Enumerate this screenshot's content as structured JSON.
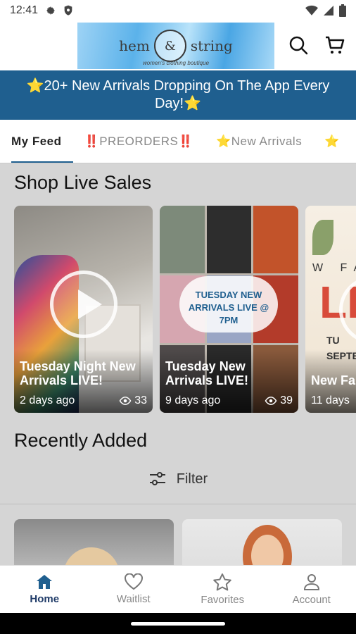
{
  "status_bar": {
    "time": "12:41"
  },
  "header": {
    "logo_left": "hem",
    "logo_mid": "&",
    "logo_right": "string",
    "logo_tagline": "women's clothing boutique"
  },
  "banner": {
    "text": "⭐20+ New Arrivals Dropping On The App Every Day!⭐"
  },
  "tabs": [
    {
      "label": "My Feed",
      "active": true
    },
    {
      "label": "‼️PREORDERS‼️",
      "active": false
    },
    {
      "label": "⭐New Arrivals",
      "active": false
    },
    {
      "label": "⭐",
      "active": false
    }
  ],
  "live_sales": {
    "title": "Shop Live Sales",
    "videos": [
      {
        "title": "Tuesday Night New Arrivals LIVE!",
        "age": "2 days ago",
        "views": "33"
      },
      {
        "title": "Tuesday New Arrivals LIVE!",
        "age": "9 days ago",
        "views": "39",
        "thumb_text": "TUESDAY NEW ARRIVALS LIVE @ 7PM"
      },
      {
        "title": "New Fa LIVE!",
        "age": "11 days",
        "views": "",
        "thumb_text_top": "W FA",
        "thumb_text_big": "LI",
        "thumb_text_small": "TU SEPTE"
      }
    ]
  },
  "recently_added": {
    "title": "Recently Added",
    "filter_label": "Filter"
  },
  "bottom_nav": [
    {
      "label": "Home",
      "icon": "home-icon",
      "active": true
    },
    {
      "label": "Waitlist",
      "icon": "heart-icon",
      "active": false
    },
    {
      "label": "Favorites",
      "icon": "star-icon",
      "active": false
    },
    {
      "label": "Account",
      "icon": "person-icon",
      "active": false
    }
  ],
  "colors": {
    "primary": "#1f5f8f",
    "nav_active": "#1f3b68"
  }
}
